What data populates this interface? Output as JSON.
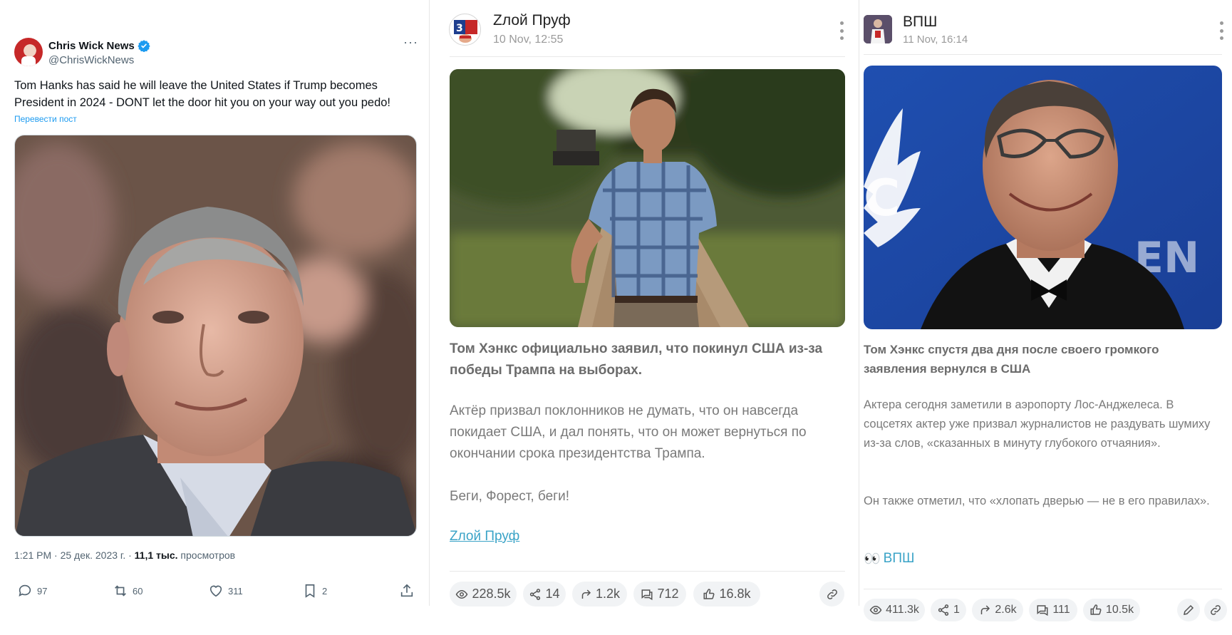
{
  "tweet": {
    "author_name": "Chris Wick News",
    "handle": "@ChrisWickNews",
    "more": "···",
    "text": "Tom Hanks has said he will leave the United States if Trump becomes President in 2024 - DONT let the door hit you on your way out you pedo!",
    "translate_link": "Перевести пост",
    "time_date": "1:21 PM · 25 дек. 2023 г. · ",
    "views_count": "11,1 тыс.",
    "views_label": " просмотров",
    "actions": {
      "replies": "97",
      "reposts": "60",
      "likes": "311",
      "bookmarks": "2"
    },
    "icons": [
      "verified-badge-icon",
      "more-icon",
      "reply-icon",
      "repost-icon",
      "like-icon",
      "bookmark-icon",
      "share-icon"
    ]
  },
  "post2": {
    "channel": "Ζлой Пруф",
    "date": "10 Nov, 12:55",
    "headline": "Том Хэнкс официально заявил, что покинул США из-за победы Трампа на выборах.",
    "body1": "Актёр призвал поклонников не думать, что он навсегда покидает США, и дал понять, что он может вернуться по окончании срока президентства Трампа.",
    "body2": "Беги, Форест, беги!",
    "signature_link": "Ζлой Пруф",
    "stats": {
      "views": "228.5k",
      "shares": "14",
      "forwards": "1.2k",
      "comments": "712",
      "likes": "16.8k"
    }
  },
  "post3": {
    "channel": "ВПШ",
    "date": "11 Nov, 16:14",
    "headline": "Том Хэнкс спустя два дня после своего громкого заявления вернулся в США",
    "body1": "Актера сегодня заметили в аэропорту Лос-Анджелеса. В соцсетях актер уже призвал журналистов не раздувать шумиху из-за слов, «сказанных в минуту глубокого отчаяния».",
    "body2": "Он также отметил, что «хлопать дверью — не в его правилах».",
    "signature_emoji": "👀",
    "signature_link": "ВПШ",
    "stats": {
      "views": "411.3k",
      "shares": "1",
      "forwards": "2.6k",
      "comments": "111",
      "likes": "10.5k"
    }
  },
  "colors": {
    "tweet_link": "#1d9bf0",
    "tg_link": "#3aa3c7",
    "pill_bg": "#f1f3f5"
  }
}
